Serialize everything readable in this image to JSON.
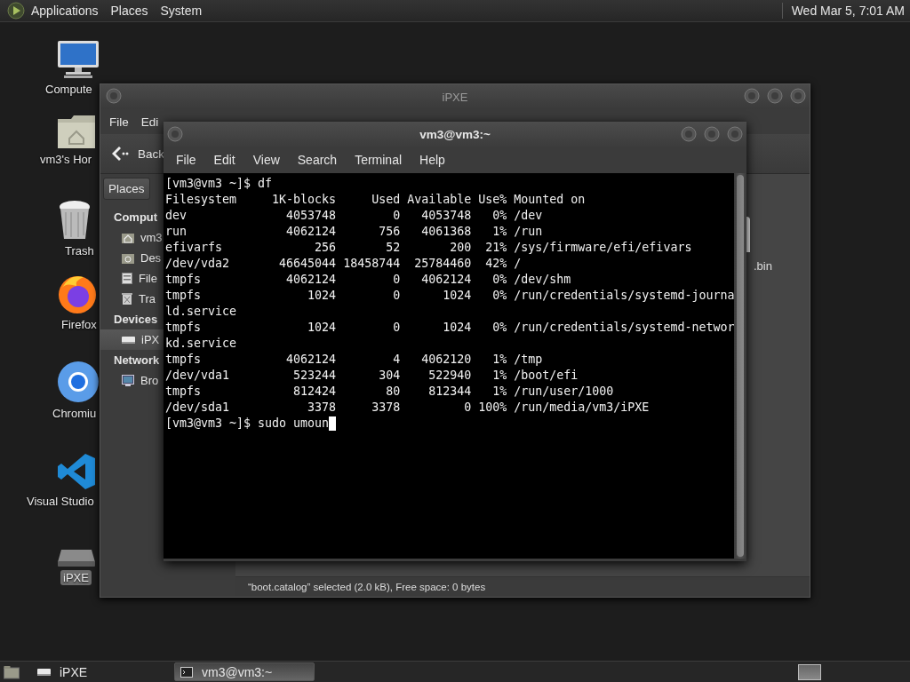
{
  "top_panel": {
    "menus": [
      "Applications",
      "Places",
      "System"
    ],
    "clock": "Wed Mar 5, 7:01 AM"
  },
  "desktop_icons": [
    {
      "label": "Compute",
      "kind": "computer",
      "selected": false
    },
    {
      "label": "vm3's Hor",
      "kind": "home",
      "selected": false
    },
    {
      "label": "Trash",
      "kind": "trash",
      "selected": false
    },
    {
      "label": "Firefox",
      "kind": "firefox",
      "selected": false
    },
    {
      "label": "Chromiu",
      "kind": "chromium",
      "selected": false
    },
    {
      "label": "Visual Studio",
      "kind": "vscode",
      "selected": false
    },
    {
      "label": "iPXE",
      "kind": "drive",
      "selected": true
    }
  ],
  "file_manager": {
    "title": "iPXE",
    "menu": [
      "File",
      "Edi"
    ],
    "back_button": "Back",
    "places_button": "Places",
    "sidebar": [
      {
        "heading": "Comput",
        "items": [
          {
            "label": "vm3",
            "kind": "home",
            "selected": false
          },
          {
            "label": "Des",
            "kind": "desktop",
            "selected": false
          },
          {
            "label": "File",
            "kind": "filesystem",
            "selected": false
          },
          {
            "label": "Tra",
            "kind": "trash",
            "selected": false
          }
        ]
      },
      {
        "heading": "Devices",
        "items": [
          {
            "label": "iPX",
            "kind": "drive",
            "selected": true
          }
        ]
      },
      {
        "heading": "Network",
        "items": [
          {
            "label": "Bro",
            "kind": "network",
            "selected": false
          }
        ]
      }
    ],
    "files": [
      {
        "name": ".bin"
      }
    ],
    "status": "“boot.catalog” selected (2.0 kB), Free space: 0 bytes"
  },
  "terminal": {
    "title": "vm3@vm3:~",
    "menu": [
      "File",
      "Edit",
      "View",
      "Search",
      "Terminal",
      "Help"
    ],
    "lines": [
      "[vm3@vm3 ~]$ df",
      "Filesystem     1K-blocks     Used Available Use% Mounted on",
      "dev              4053748        0   4053748   0% /dev",
      "run              4062124      756   4061368   1% /run",
      "efivarfs             256       52       200  21% /sys/firmware/efi/efivars",
      "/dev/vda2       46645044 18458744  25784460  42% /",
      "tmpfs            4062124        0   4062124   0% /dev/shm",
      "tmpfs               1024        0      1024   0% /run/credentials/systemd-journa",
      "ld.service",
      "tmpfs               1024        0      1024   0% /run/credentials/systemd-networ",
      "kd.service",
      "tmpfs            4062124        4   4062120   1% /tmp",
      "/dev/vda1         523244      304    522940   1% /boot/efi",
      "tmpfs             812424       80    812344   1% /run/user/1000",
      "/dev/sda1           3378     3378         0 100% /run/media/vm3/iPXE",
      "[vm3@vm3 ~]$ sudo umoun"
    ]
  },
  "taskbar": {
    "tasks": [
      {
        "label": "iPXE",
        "kind": "drive",
        "selected": false
      },
      {
        "label": "vm3@vm3:~",
        "kind": "terminal",
        "selected": true
      }
    ]
  }
}
